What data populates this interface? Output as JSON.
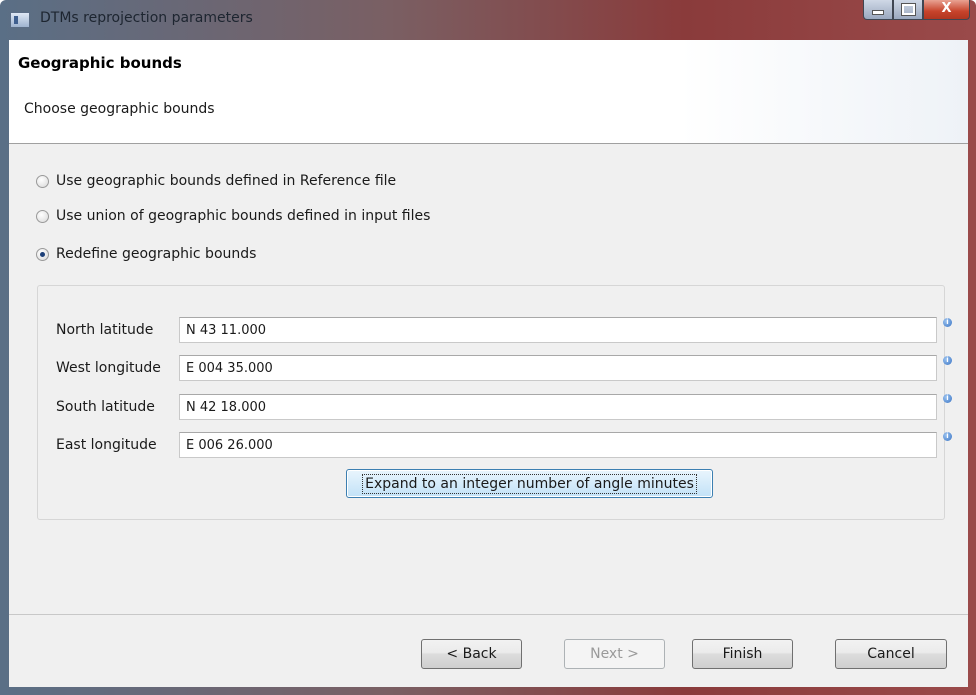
{
  "window": {
    "title": "DTMs reprojection parameters",
    "controls": {
      "minimize": "–",
      "maximize": "□",
      "close": "X"
    }
  },
  "header": {
    "title": "Geographic bounds",
    "subtitle": "Choose geographic bounds"
  },
  "options": [
    {
      "label": "Use geographic bounds defined in Reference file",
      "checked": false
    },
    {
      "label": "Use union of geographic bounds defined in input files",
      "checked": false
    },
    {
      "label": "Redefine geographic bounds",
      "checked": true
    }
  ],
  "bounds": {
    "fields": [
      {
        "label": "North latitude",
        "value": "N 43 11.000"
      },
      {
        "label": "West longitude",
        "value": "E 004 35.000"
      },
      {
        "label": "South latitude",
        "value": "N 42 18.000"
      },
      {
        "label": "East longitude",
        "value": "E 006 26.000"
      }
    ],
    "info_glyph": "i",
    "expand_label": "Expand to an integer number of angle minutes"
  },
  "footer": {
    "back": "< Back",
    "next": "Next >",
    "finish": "Finish",
    "cancel": "Cancel"
  }
}
